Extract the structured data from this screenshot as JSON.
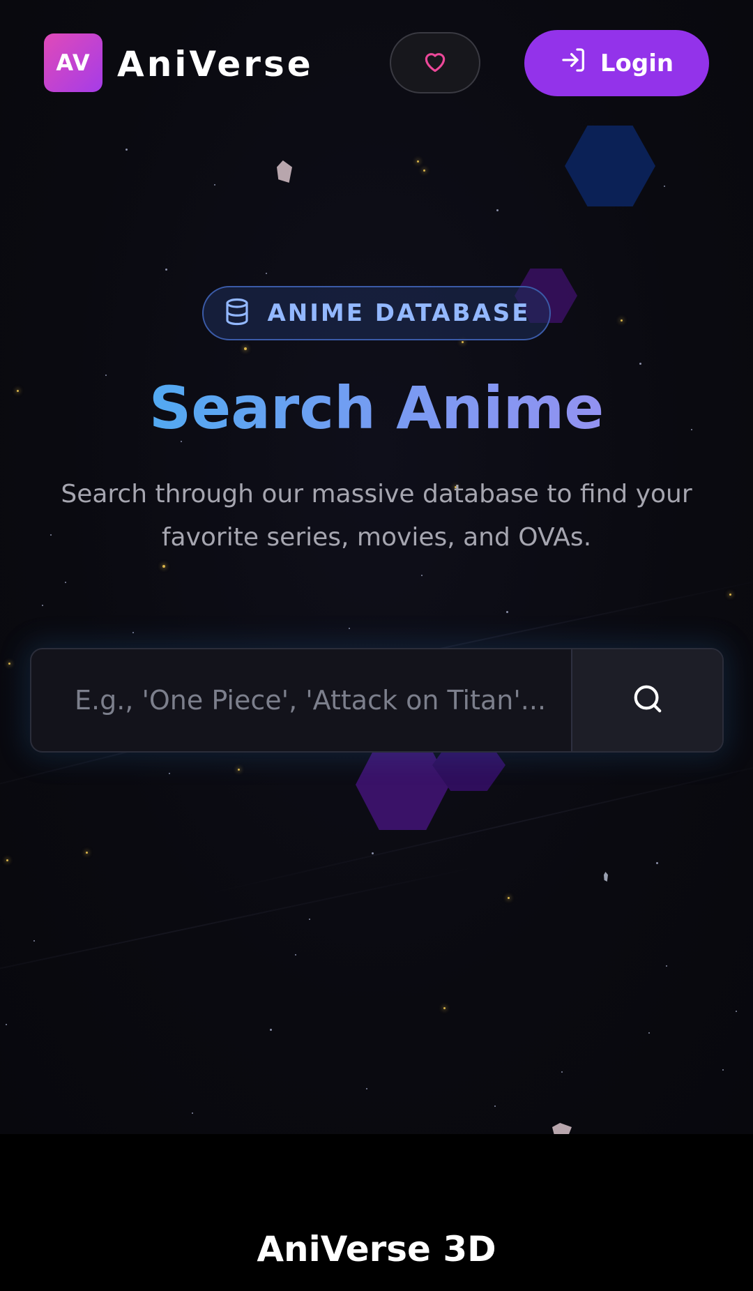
{
  "header": {
    "logo_text": "AV",
    "brand": "AniVerse",
    "favorites_icon": "heart-icon",
    "login_label": "Login",
    "login_icon": "login-arrow-icon"
  },
  "hero": {
    "badge_icon": "database-icon",
    "badge_label": "ANIME DATABASE",
    "title": "Search Anime",
    "subtitle": "Search through our massive database to find your favorite series, movies, and OVAs."
  },
  "search": {
    "placeholder": "E.g., 'One Piece', 'Attack on Titan'...",
    "value": "",
    "button_icon": "search-icon"
  },
  "footer": {
    "title": "AniVerse 3D"
  },
  "colors": {
    "background": "#0a0a10",
    "accent_purple": "#9333ea",
    "badge_text": "#93b8ff",
    "heart_pink": "#ec4899",
    "logo_gradient_start": "#e04ab8",
    "logo_gradient_end": "#a53ce8"
  }
}
